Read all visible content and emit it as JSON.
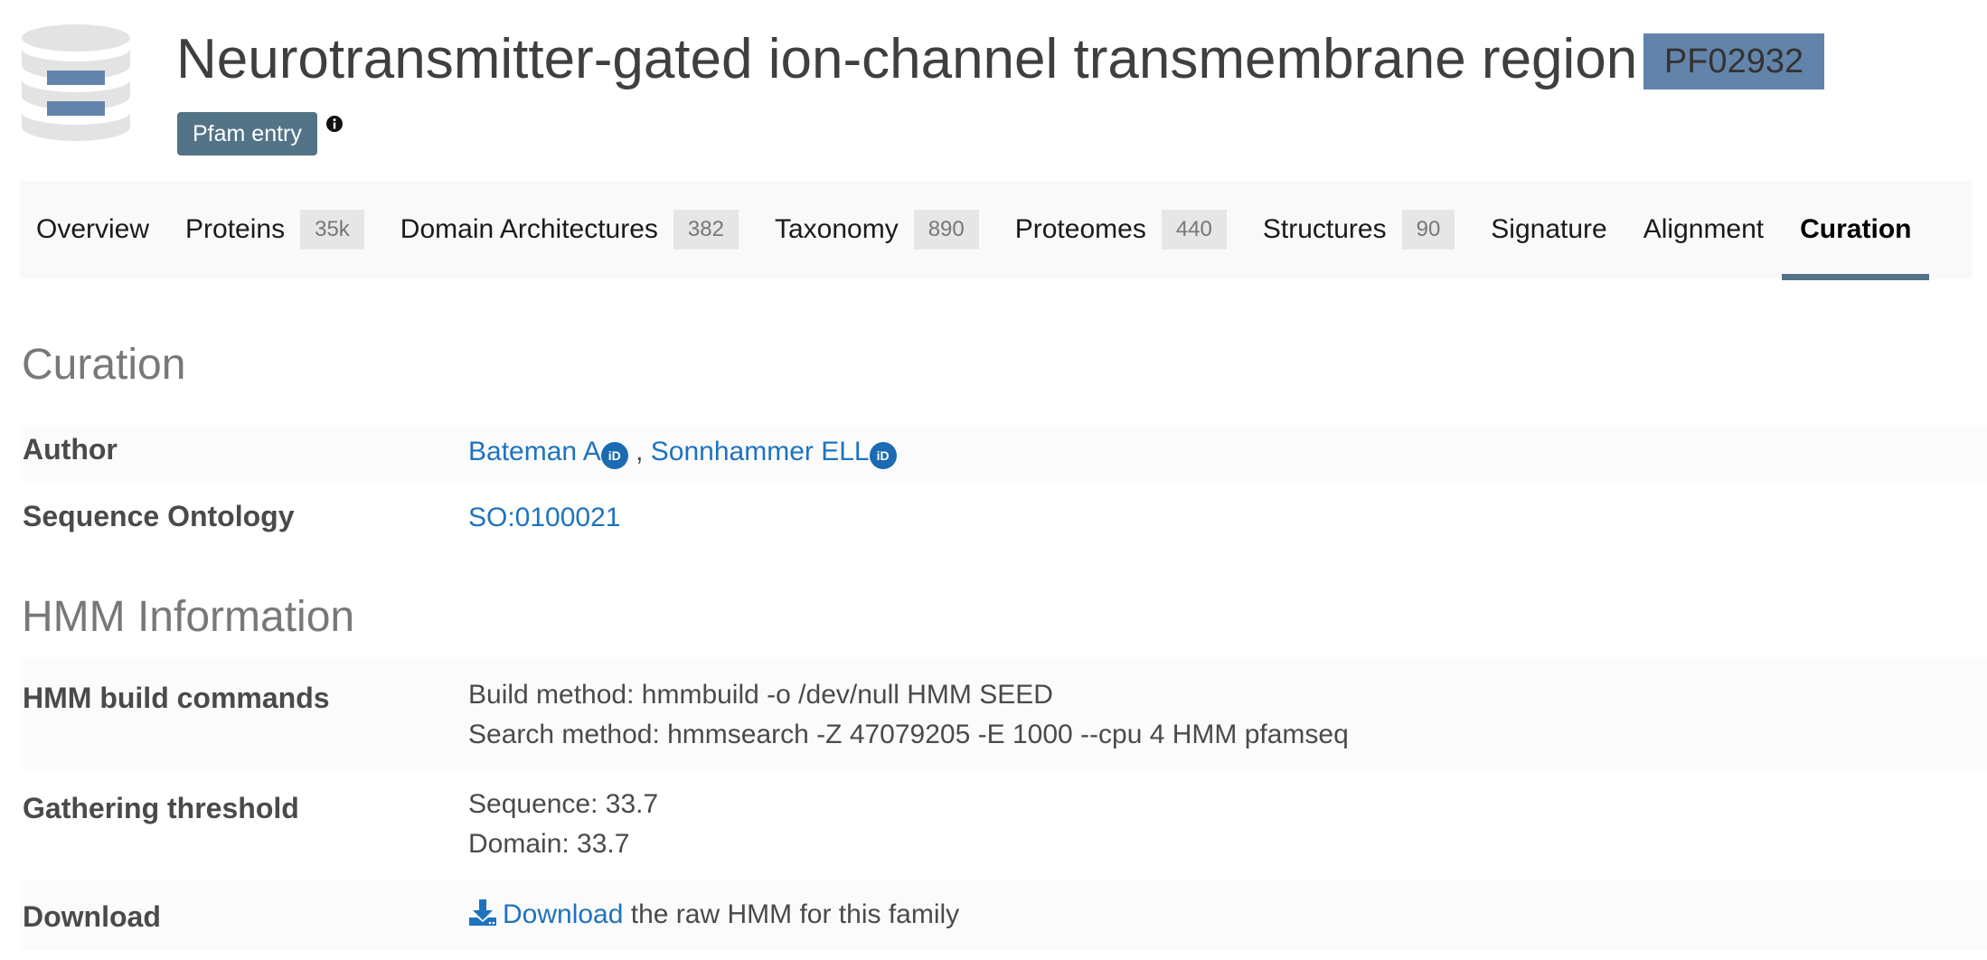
{
  "header": {
    "title": "Neurotransmitter-gated ion-channel transmembrane region",
    "accession": "PF02932",
    "badge": "Pfam entry"
  },
  "tabs": [
    {
      "label": "Overview",
      "count": ""
    },
    {
      "label": "Proteins",
      "count": "35k"
    },
    {
      "label": "Domain Architectures",
      "count": "382"
    },
    {
      "label": "Taxonomy",
      "count": "890"
    },
    {
      "label": "Proteomes",
      "count": "440"
    },
    {
      "label": "Structures",
      "count": "90"
    },
    {
      "label": "Signature",
      "count": ""
    },
    {
      "label": "Alignment",
      "count": ""
    },
    {
      "label": "Curation",
      "count": ""
    }
  ],
  "active_tab": "Curation",
  "curation": {
    "title": "Curation",
    "author_label": "Author",
    "authors": [
      "Bateman A",
      "Sonnhammer ELL"
    ],
    "author_separator": " , ",
    "ontology_label": "Sequence Ontology",
    "ontology_value": "SO:0100021"
  },
  "hmm": {
    "title": "HMM Information",
    "build_label": "HMM build commands",
    "build_method": "Build method: hmmbuild -o /dev/null HMM SEED",
    "search_method": "Search method: hmmsearch -Z 47079205 -E 1000 --cpu 4 HMM pfamseq",
    "threshold_label": "Gathering threshold",
    "threshold_sequence": "Sequence: 33.7",
    "threshold_domain": "Domain: 33.7",
    "download_label": "Download",
    "download_link": "Download",
    "download_suffix": " the raw HMM for this family"
  },
  "colors": {
    "accent": "#537386",
    "accession_bg": "#6384aa",
    "link": "#1e73be",
    "orcid": "#1a6bb1"
  },
  "icons": [
    "database-icon",
    "info-icon",
    "orcid-icon",
    "download-icon"
  ]
}
